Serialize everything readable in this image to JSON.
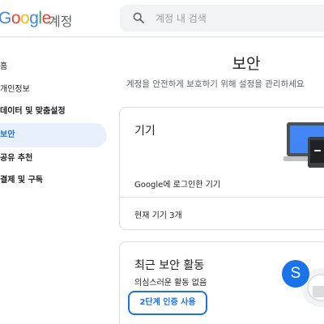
{
  "header": {
    "logo_text": "Google",
    "product_name": "계정",
    "search_placeholder": "계정 내 검색",
    "colors": {
      "blue": "#4285F4",
      "red": "#EA4335",
      "yellow": "#FBBC05",
      "green": "#34A853"
    }
  },
  "sidebar": {
    "items": [
      {
        "label": "홈",
        "active": false
      },
      {
        "label": "개인정보",
        "active": false
      },
      {
        "label": "데이터 및 맞춤설정",
        "active": false
      },
      {
        "label": "보안",
        "active": true
      },
      {
        "label": "공유 추천",
        "active": false
      },
      {
        "label": "결제 및 구독",
        "active": false
      }
    ]
  },
  "main": {
    "title": "보안",
    "subtitle": "계정을 안전하게 보호하기 위해 설정을 관리하세요"
  },
  "devices_card": {
    "title": "기기",
    "signed_in_text": "Google에 로그인한 기기",
    "current_devices": "현재 기기 3개"
  },
  "activity_card": {
    "title": "최근 보안 활동",
    "subtitle": "의심스러운 활동 없음",
    "button_label": "2단계 인증 사용",
    "avatar_letter": "S"
  },
  "accent_color": "#1a73e8"
}
